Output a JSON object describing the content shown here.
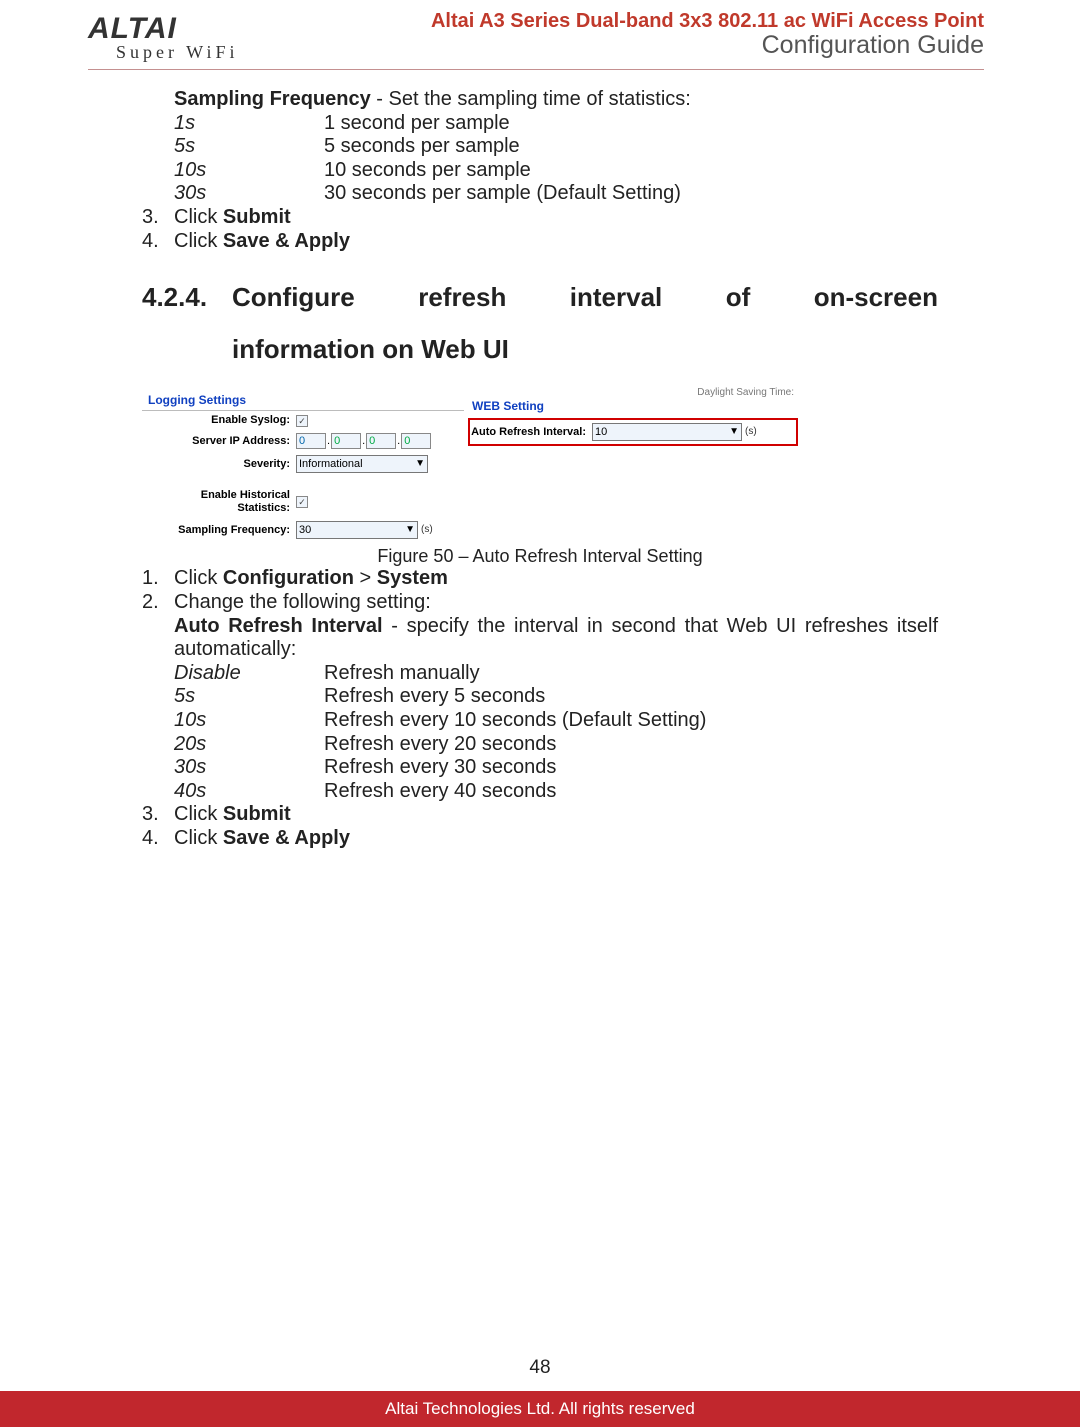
{
  "header": {
    "logo_main": "ALTAI",
    "logo_sub": "Super WiFi",
    "title_line1": "Altai A3 Series Dual-band 3x3 802.11 ac WiFi Access Point",
    "title_line2": "Configuration Guide"
  },
  "section_a": {
    "sampling_label": "Sampling Frequency",
    "sampling_desc": " - Set the sampling time of statistics:",
    "rows": [
      {
        "k": "1s",
        "v": "1 second per sample"
      },
      {
        "k": "5s",
        "v": "5 seconds per sample"
      },
      {
        "k": "10s",
        "v": "10 seconds per sample"
      },
      {
        "k": "30s",
        "v": "30 seconds per sample (Default Setting)"
      }
    ],
    "step3_num": "3.",
    "step3_a": "Click ",
    "step3_b": "Submit",
    "step4_num": "4.",
    "step4_a": "Click ",
    "step4_b": "Save & Apply"
  },
  "heading": {
    "num": "4.2.4.",
    "w1": "Configure",
    "w2": "refresh",
    "w3": "interval",
    "w4": "of",
    "w5": "on-screen",
    "line2": "information on Web UI"
  },
  "figure": {
    "daylight": "Daylight Saving Time:",
    "logging_title": "Logging Settings",
    "web_title": "WEB Setting",
    "enable_syslog": "Enable Syslog:",
    "server_ip": "Server IP Address:",
    "ip": [
      "0",
      "0",
      "0",
      "0"
    ],
    "severity_lbl": "Severity:",
    "severity_val": "Informational",
    "ehs": "Enable Historical Statistics:",
    "sfreq_lbl": "Sampling Frequency:",
    "sfreq_val": "30",
    "ari_lbl": "Auto Refresh Interval:",
    "ari_val": "10",
    "unit": "(s)",
    "check": "✓",
    "caption": "Figure 50 – Auto Refresh Interval Setting"
  },
  "section_b": {
    "step1_num": "1.",
    "step1_a": "Click ",
    "step1_b": "Configuration",
    "step1_c": " > ",
    "step1_d": "System",
    "step2_num": "2.",
    "step2_a": "Change the following setting:",
    "ari_bold": "Auto Refresh Interval",
    "ari_desc": " - specify the interval in second that Web UI refreshes itself automatically:",
    "rows": [
      {
        "k": "Disable",
        "v": "Refresh manually"
      },
      {
        "k": "5s",
        "v": "Refresh every 5 seconds"
      },
      {
        "k": "10s",
        "v": "Refresh every 10 seconds (Default Setting)"
      },
      {
        "k": "20s",
        "v": "Refresh every 20 seconds"
      },
      {
        "k": "30s",
        "v": "Refresh every 30 seconds"
      },
      {
        "k": "40s",
        "v": "Refresh every 40 seconds"
      }
    ],
    "step3_num": "3.",
    "step3_a": "Click ",
    "step3_b": "Submit",
    "step4_num": "4.",
    "step4_a": "Click ",
    "step4_b": "Save & Apply"
  },
  "footer": {
    "page": "48",
    "copyright": "Altai Technologies Ltd. All rights reserved"
  }
}
